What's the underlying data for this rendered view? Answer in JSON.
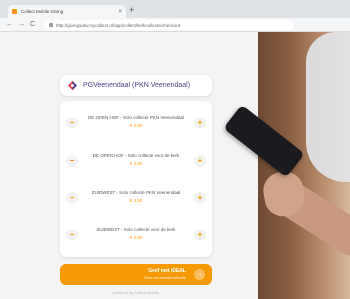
{
  "browser": {
    "tab_title": "Collect Mobile Giving",
    "tab_close": "×",
    "new_tab": "+",
    "back": "←",
    "forward": "→",
    "reload": "C",
    "url": "http://givingsdev.mycollect.nl/app/collect/kerkcollecte/checkout"
  },
  "header": {
    "org_name": "PGVeenendaal (PKN Veenendaal)"
  },
  "products": [
    {
      "name": "DE OPEN HOF - Solo collecte PKN Veenendaal",
      "price": "€ 2,50",
      "minus": "−",
      "plus": "+"
    },
    {
      "name": "DE OPEN HOF - Solo collecte voor de kerk",
      "price": "€ 2,50",
      "minus": "−",
      "plus": "+"
    },
    {
      "name": "ZUIDWEST - Solo collecte PKN Veenendaal",
      "price": "€ 2,50",
      "minus": "−",
      "plus": "+"
    },
    {
      "name": "ZUIDWEST - Solo collecte voor de kerk",
      "price": "€ 2,50",
      "minus": "−",
      "plus": "+"
    }
  ],
  "pay": {
    "label": "Geef met iDEAL",
    "sub": "Kies uw betaalmethode",
    "arrow": "→"
  },
  "footer": "powered by Collect Mobile",
  "colors": {
    "accent": "#f59a06",
    "org_name": "#4f3f86"
  }
}
